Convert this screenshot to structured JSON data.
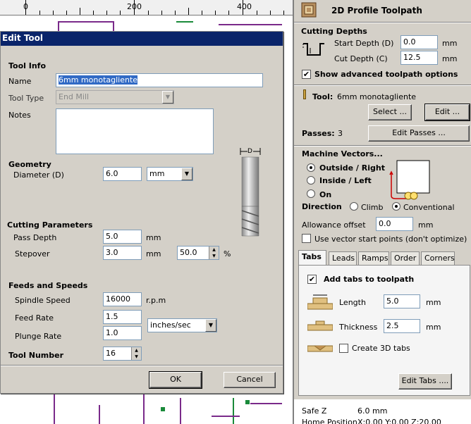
{
  "ruler": {
    "labels": [
      "0",
      "200",
      "400"
    ]
  },
  "dialog": {
    "title": "Edit Tool",
    "tool_info": {
      "group_label": "Tool Info",
      "name_label": "Name",
      "name_value": "6mm monotagliente",
      "type_label": "Tool Type",
      "type_value": "End Mill",
      "notes_label": "Notes",
      "notes_value": ""
    },
    "geometry": {
      "group_label": "Geometry",
      "diameter_label": "Diameter (D)",
      "diameter_value": "6.0",
      "units_value": "mm",
      "diagram_label": "D"
    },
    "cutting": {
      "group_label": "Cutting Parameters",
      "pass_depth_label": "Pass Depth",
      "pass_depth_value": "5.0",
      "pass_depth_unit": "mm",
      "stepover_label": "Stepover",
      "stepover_value": "3.0",
      "stepover_unit": "mm",
      "stepover_pct_value": "50.0",
      "pct_symbol": "%"
    },
    "feeds": {
      "group_label": "Feeds and Speeds",
      "spindle_label": "Spindle Speed",
      "spindle_value": "16000",
      "spindle_unit": "r.p.m",
      "feed_label": "Feed Rate",
      "feed_value": "1.5",
      "plunge_label": "Plunge Rate",
      "plunge_value": "1.0",
      "rate_units_value": "inches/sec"
    },
    "tool_number_label": "Tool Number",
    "tool_number_value": "16",
    "ok_label": "OK",
    "cancel_label": "Cancel"
  },
  "panel": {
    "title": "2D Profile Toolpath",
    "cutting_depths": {
      "label": "Cutting Depths",
      "start_label": "Start Depth (D)",
      "start_value": "0.0",
      "start_unit": "mm",
      "cut_label": "Cut Depth (C)",
      "cut_value": "12.5",
      "cut_unit": "mm",
      "advanced_label": "Show advanced toolpath options",
      "advanced_checked": true
    },
    "tool": {
      "label": "Tool:",
      "value": "6mm monotagliente",
      "select_label": "Select ...",
      "edit_label": "Edit ..."
    },
    "passes": {
      "label": "Passes:",
      "value": "3",
      "edit_label": "Edit Passes ..."
    },
    "machine_vectors": {
      "label": "Machine Vectors...",
      "options": [
        "Outside / Right",
        "Inside / Left",
        "On"
      ],
      "selected": 0,
      "direction_label": "Direction",
      "climb_label": "Climb",
      "conventional_label": "Conventional",
      "direction_selected": "Conventional",
      "allowance_label": "Allowance offset",
      "allowance_value": "0.0",
      "allowance_unit": "mm",
      "vector_start_label": "Use vector start points (don't optimize)"
    },
    "tabs": [
      "Tabs",
      "Leads",
      "Ramps",
      "Order",
      "Corners"
    ],
    "active_tab": "Tabs",
    "tabs_panel": {
      "add_tabs_label": "Add tabs to toolpath",
      "add_tabs_checked": true,
      "length_label": "Length",
      "length_value": "5.0",
      "length_unit": "mm",
      "thickness_label": "Thickness",
      "thickness_value": "2.5",
      "thickness_unit": "mm",
      "create3d_label": "Create 3D tabs",
      "edit_tabs_label": "Edit Tabs ...."
    },
    "safe_z_label": "Safe Z",
    "safe_z_value": "6.0 mm",
    "home_label": "Home Position",
    "home_value": "X:0.00 Y:0.00 Z:20.00"
  },
  "colors": {
    "title_bar": "#0a246a",
    "cad_purple": "#7a2a8a",
    "cad_green": "#1a8a3a",
    "selection": "#316ac5"
  }
}
